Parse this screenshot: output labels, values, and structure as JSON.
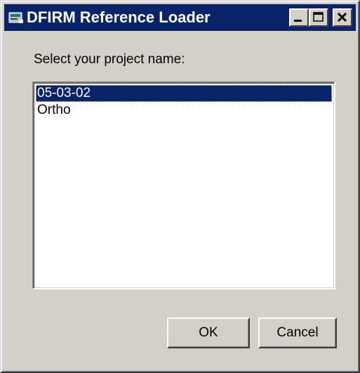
{
  "window": {
    "title": "DFIRM Reference Loader",
    "controls": [
      "minimize-icon",
      "maximize-icon",
      "close-icon"
    ]
  },
  "prompt": {
    "label": "Select your project name:"
  },
  "projects": {
    "items": [
      "05-03-02",
      "Ortho"
    ],
    "selected": "05-03-02"
  },
  "buttons": {
    "ok_label": "OK",
    "cancel_label": "Cancel"
  },
  "colors": {
    "titlebar": "#0a246a",
    "face": "#d4d0c8",
    "selection": "#0a246a"
  }
}
